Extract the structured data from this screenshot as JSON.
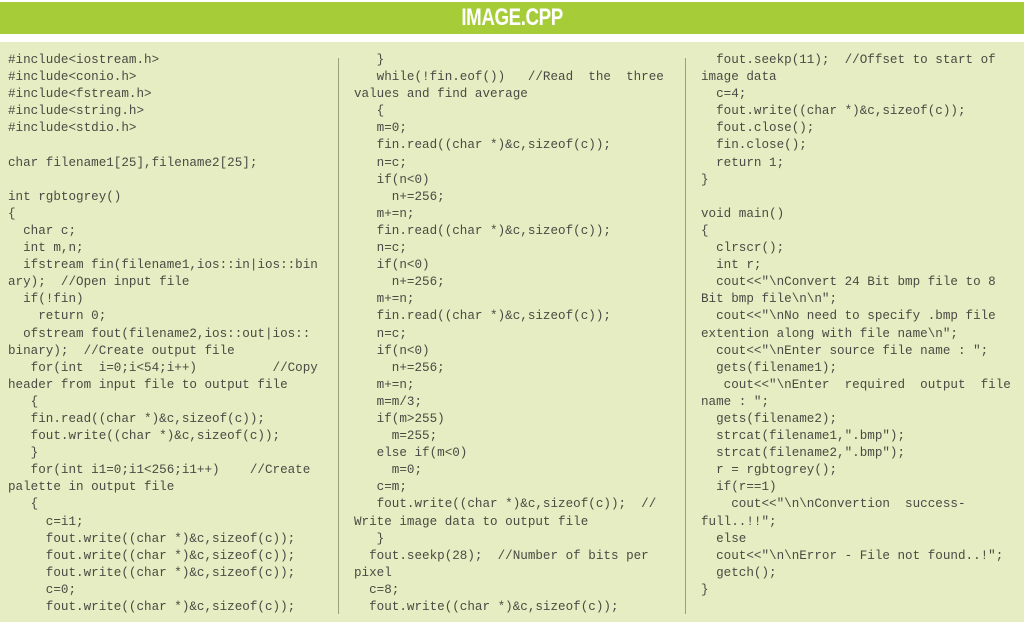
{
  "header": {
    "title": "IMAGE.CPP",
    "background_color": "#a6cd38",
    "text_color": "#ffffff"
  },
  "panel": {
    "background_color": "#e7edc2",
    "text_color": "#4a4a44"
  },
  "columns": [
    {
      "lines": [
        "#include<iostream.h>",
        "#include<conio.h>",
        "#include<fstream.h>",
        "#include<string.h>",
        "#include<stdio.h>",
        "",
        "char filename1[25],filename2[25];",
        "",
        "int rgbtogrey()",
        "{",
        "  char c;",
        "  int m,n;",
        "  ifstream fin(filename1,ios::in|ios::bin",
        "ary);  //Open input file",
        "  if(!fin)",
        "    return 0;",
        "  ofstream fout(filename2,ios::out|ios::",
        "binary);  //Create output file",
        "   for(int  i=0;i<54;i++)          //Copy",
        "header from input file to output file",
        "   {",
        "   fin.read((char *)&c,sizeof(c));",
        "   fout.write((char *)&c,sizeof(c));",
        "   }",
        "   for(int i1=0;i1<256;i1++)    //Create",
        "palette in output file",
        "   {",
        "     c=i1;",
        "     fout.write((char *)&c,sizeof(c));",
        "     fout.write((char *)&c,sizeof(c));",
        "     fout.write((char *)&c,sizeof(c));",
        "     c=0;",
        "     fout.write((char *)&c,sizeof(c));"
      ]
    },
    {
      "lines": [
        "   }",
        "   while(!fin.eof())   //Read  the  three",
        "values and find average",
        "   {",
        "   m=0;",
        "   fin.read((char *)&c,sizeof(c));",
        "   n=c;",
        "   if(n<0)",
        "     n+=256;",
        "   m+=n;",
        "   fin.read((char *)&c,sizeof(c));",
        "   n=c;",
        "   if(n<0)",
        "     n+=256;",
        "   m+=n;",
        "   fin.read((char *)&c,sizeof(c));",
        "   n=c;",
        "   if(n<0)",
        "     n+=256;",
        "   m+=n;",
        "   m=m/3;",
        "   if(m>255)",
        "     m=255;",
        "   else if(m<0)",
        "     m=0;",
        "   c=m;",
        "   fout.write((char *)&c,sizeof(c));  //",
        "Write image data to output file",
        "   }",
        "  fout.seekp(28);  //Number of bits per",
        "pixel",
        "  c=8;",
        "  fout.write((char *)&c,sizeof(c));"
      ]
    },
    {
      "lines": [
        "  fout.seekp(11);  //Offset to start of",
        "image data",
        "  c=4;",
        "  fout.write((char *)&c,sizeof(c));",
        "  fout.close();",
        "  fin.close();",
        "  return 1;",
        "}",
        "",
        "void main()",
        "{",
        "  clrscr();",
        "  int r;",
        "  cout<<\"\\nConvert 24 Bit bmp file to 8",
        "Bit bmp file\\n\\n\";",
        "  cout<<\"\\nNo need to specify .bmp file",
        "extention along with file name\\n\";",
        "  cout<<\"\\nEnter source file name : \";",
        "  gets(filename1);",
        "   cout<<\"\\nEnter  required  output  file",
        "name : \";",
        "  gets(filename2);",
        "  strcat(filename1,\".bmp\");",
        "  strcat(filename2,\".bmp\");",
        "  r = rgbtogrey();",
        "  if(r==1)",
        "    cout<<\"\\n\\nConvertion  success-",
        "full..!!\";",
        "  else",
        "  cout<<\"\\n\\nError - File not found..!\";",
        "  getch();",
        "}"
      ]
    }
  ]
}
